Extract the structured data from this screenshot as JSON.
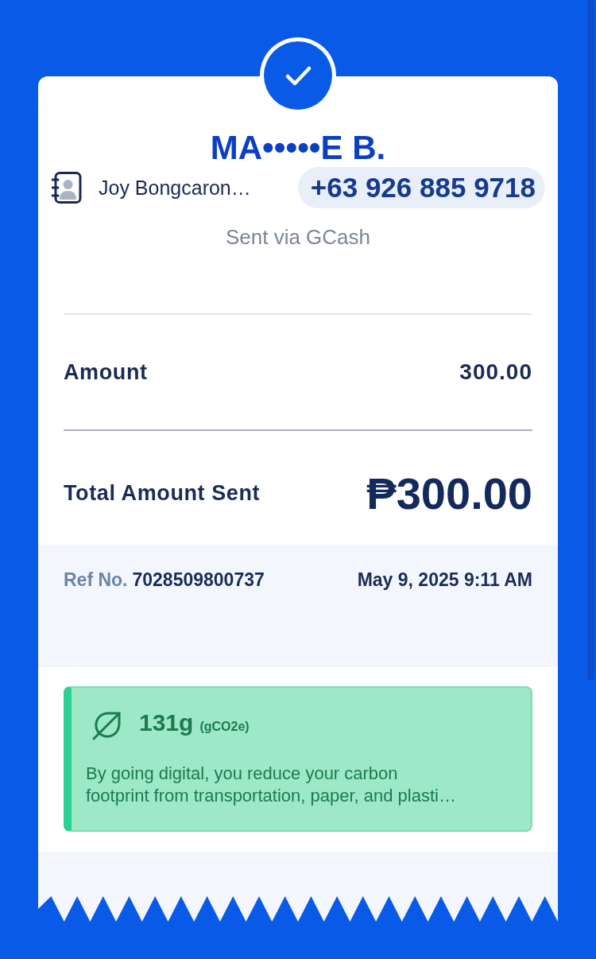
{
  "recipient": {
    "masked_name": "MA•••••E B.",
    "contact_name": "Joy Bongcaron…",
    "phone": "+63 926 885 9718",
    "channel": "Sent via GCash"
  },
  "details": [
    {
      "kind": "amount",
      "label": "Amount",
      "value": "300.00"
    },
    {
      "kind": "total",
      "label": "Total Amount Sent",
      "value": "₱300.00"
    }
  ],
  "reference": {
    "label": "Ref No.",
    "number": "7028509800737",
    "datetime": "May 9, 2025 9:11 AM"
  },
  "carbon_note": {
    "value": "131g",
    "unit": "(gCO2e)",
    "message": "By going digital, you reduce your carbon\nfootprint from transportation, paper, and plasti…"
  }
}
